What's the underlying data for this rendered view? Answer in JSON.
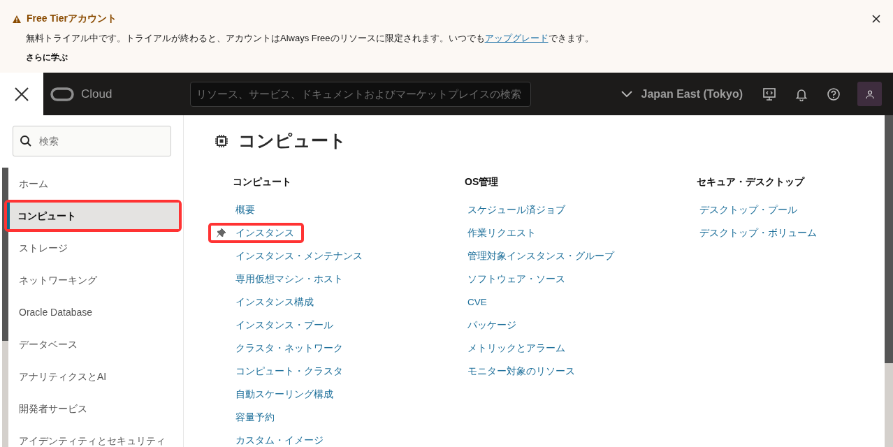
{
  "banner": {
    "title": "Free Tierアカウント",
    "message_before": "無料トライアル中です。トライアルが終わると、アカウントはAlways Freeのリソースに限定されます。いつでも",
    "link": "アップグレード",
    "message_after": "できます。",
    "learn_more": "さらに学ぶ"
  },
  "header": {
    "brand": "Cloud",
    "search": {
      "placeholder": "リソース、サービス、ドキュメントおよびマーケットプレイスの検索"
    },
    "region": "Japan East (Tokyo)"
  },
  "sidebar": {
    "search": {
      "placeholder": "検索"
    },
    "items": [
      {
        "label": "ホーム",
        "selected": false,
        "highlighted": false
      },
      {
        "label": "コンピュート",
        "selected": true,
        "highlighted": true
      },
      {
        "label": "ストレージ",
        "selected": false,
        "highlighted": false
      },
      {
        "label": "ネットワーキング",
        "selected": false,
        "highlighted": false
      },
      {
        "label": "Oracle Database",
        "selected": false,
        "highlighted": false
      },
      {
        "label": "データベース",
        "selected": false,
        "highlighted": false
      },
      {
        "label": "アナリティクスとAI",
        "selected": false,
        "highlighted": false
      },
      {
        "label": "開発者サービス",
        "selected": false,
        "highlighted": false
      },
      {
        "label": "アイデンティティとセキュリティ",
        "selected": false,
        "highlighted": false
      }
    ]
  },
  "main": {
    "title": "コンピュート",
    "columns": [
      {
        "heading": "コンピュート",
        "links": [
          {
            "label": "概要",
            "pinned": false,
            "highlighted": false
          },
          {
            "label": "インスタンス",
            "pinned": true,
            "highlighted": true
          },
          {
            "label": "インスタンス・メンテナンス",
            "pinned": false,
            "highlighted": false
          },
          {
            "label": "専用仮想マシン・ホスト",
            "pinned": false,
            "highlighted": false
          },
          {
            "label": "インスタンス構成",
            "pinned": false,
            "highlighted": false
          },
          {
            "label": "インスタンス・プール",
            "pinned": false,
            "highlighted": false
          },
          {
            "label": "クラスタ・ネットワーク",
            "pinned": false,
            "highlighted": false
          },
          {
            "label": "コンピュート・クラスタ",
            "pinned": false,
            "highlighted": false
          },
          {
            "label": "自動スケーリング構成",
            "pinned": false,
            "highlighted": false
          },
          {
            "label": "容量予約",
            "pinned": false,
            "highlighted": false
          },
          {
            "label": "カスタム・イメージ",
            "pinned": false,
            "highlighted": false
          }
        ]
      },
      {
        "heading": "OS管理",
        "links": [
          {
            "label": "スケジュール済ジョブ",
            "pinned": false,
            "highlighted": false
          },
          {
            "label": "作業リクエスト",
            "pinned": false,
            "highlighted": false
          },
          {
            "label": "管理対象インスタンス・グループ",
            "pinned": false,
            "highlighted": false
          },
          {
            "label": "ソフトウェア・ソース",
            "pinned": false,
            "highlighted": false
          },
          {
            "label": "CVE",
            "pinned": false,
            "highlighted": false
          },
          {
            "label": "パッケージ",
            "pinned": false,
            "highlighted": false
          },
          {
            "label": "メトリックとアラーム",
            "pinned": false,
            "highlighted": false
          },
          {
            "label": "モニター対象のリソース",
            "pinned": false,
            "highlighted": false
          }
        ]
      },
      {
        "heading": "セキュア・デスクトップ",
        "links": [
          {
            "label": "デスクトップ・プール",
            "pinned": false,
            "highlighted": false
          },
          {
            "label": "デスクトップ・ボリューム",
            "pinned": false,
            "highlighted": false
          }
        ]
      }
    ]
  }
}
